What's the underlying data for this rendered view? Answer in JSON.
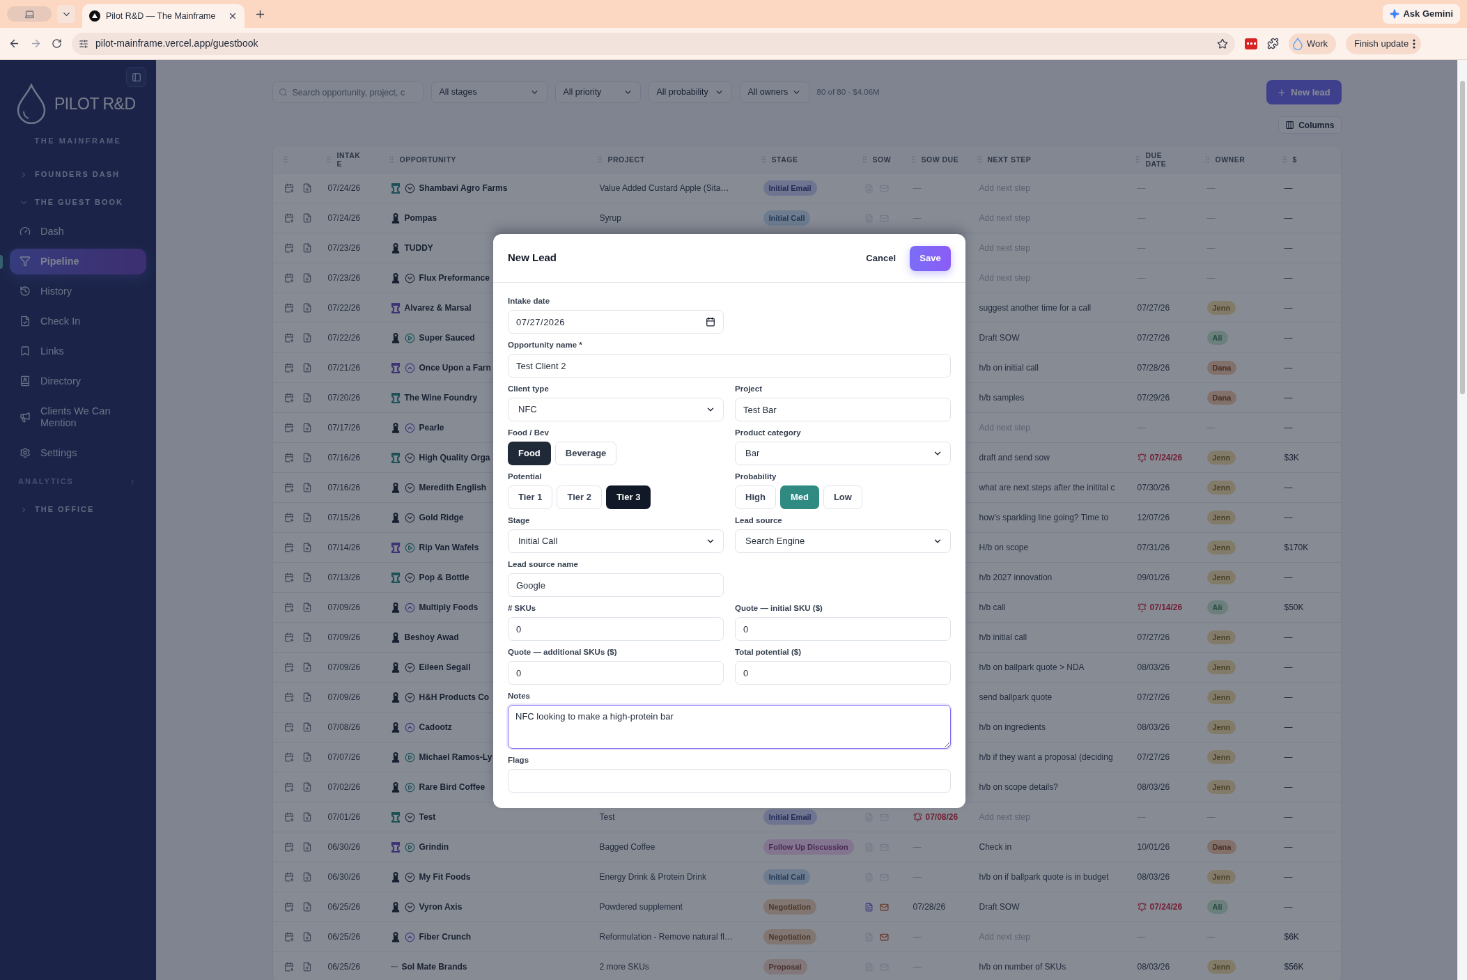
{
  "browser": {
    "tab_title": "Pilot R&D — The Mainframe",
    "gemini": "Ask Gemini",
    "url": "pilot-mainframe.vercel.app/guestbook",
    "profile": "Work",
    "update": "Finish update"
  },
  "sidebar": {
    "brand": "PILOT R&D",
    "subtitle": "THE MAINFRAME",
    "sections": [
      {
        "kind": "group",
        "label": "FOUNDERS DASH",
        "expanded": false
      },
      {
        "kind": "group",
        "label": "THE GUEST BOOK",
        "expanded": true,
        "children": [
          {
            "label": "Dash",
            "selected": false
          },
          {
            "label": "Pipeline",
            "selected": true
          },
          {
            "label": "History",
            "selected": false
          },
          {
            "label": "Check In",
            "selected": false
          },
          {
            "label": "Links",
            "selected": false
          },
          {
            "label": "Directory",
            "selected": false
          },
          {
            "label": "Clients We Can Mention",
            "selected": false
          },
          {
            "label": "Settings",
            "selected": false
          }
        ]
      },
      {
        "kind": "heading",
        "label": "ANALYTICS"
      },
      {
        "kind": "group",
        "label": "THE OFFICE",
        "expanded": false
      }
    ]
  },
  "toolbar": {
    "search_placeholder": "Search opportunity, project, c",
    "filters": [
      "All stages",
      "All priority",
      "All probability",
      "All owners"
    ],
    "summary": "80 of 80 · $4.06M",
    "new_lead": "New lead",
    "columns": "Columns"
  },
  "table": {
    "columns": [
      "INTAKE",
      "OPPORTUNITY",
      "PROJECT",
      "STAGE",
      "SOW",
      "SOW DUE",
      "NEXT STEP",
      "DUE DATE",
      "OWNER",
      "$"
    ],
    "rows": [
      {
        "intake": "07/24/26",
        "type": {
          "kind": "company",
          "color": "#1d5157"
        },
        "status": {
          "kind": "down"
        },
        "name": "Shambavi Agro Farms",
        "project": "Value Added Custard Apple (Sita…",
        "stage": {
          "label": "Initial Email",
          "color": "#6f7591"
        },
        "sow": {
          "doc": false,
          "mail": false
        },
        "sow_due": {
          "text": "—",
          "empty": true,
          "alert": false
        },
        "next_step": {
          "text": "Add next step",
          "empty": true
        },
        "due": {
          "text": "—",
          "empty": true,
          "alert": false
        },
        "owner": {
          "kind": "none",
          "text": "—"
        },
        "amount": "—"
      },
      {
        "intake": "07/24/26",
        "type": {
          "kind": "person",
          "color": "#172031"
        },
        "name": "Pompas",
        "project": "Syrup",
        "stage": {
          "label": "Initial Call",
          "color": "#6e7c90"
        },
        "sow": {
          "doc": false,
          "mail": false
        },
        "sow_due": {
          "text": "—",
          "empty": true,
          "alert": false
        },
        "next_step": {
          "text": "Add next step",
          "empty": true
        },
        "due": {
          "text": "—",
          "empty": true,
          "alert": false
        },
        "owner": {
          "kind": "none",
          "text": "—"
        },
        "amount": "—"
      },
      {
        "intake": "07/23/26",
        "type": {
          "kind": "person",
          "color": "#172031"
        },
        "name": "TUDDY",
        "next_step": {
          "text": "Add next step",
          "empty": true
        },
        "due": {
          "text": "—",
          "empty": true,
          "alert": false
        },
        "owner": {
          "kind": "none",
          "text": "—"
        },
        "amount": "—"
      },
      {
        "intake": "07/23/26",
        "type": {
          "kind": "person",
          "color": "#172031"
        },
        "status": {
          "kind": "down"
        },
        "name": "Flux Preformance",
        "next_step": {
          "text": "Add next step",
          "empty": true
        },
        "due": {
          "text": "—",
          "empty": true,
          "alert": false
        },
        "owner": {
          "kind": "none",
          "text": "—"
        },
        "amount": "—"
      },
      {
        "intake": "07/22/26",
        "type": {
          "kind": "company",
          "color": "#3e3376"
        },
        "name": "Alvarez & Marsal",
        "next_step": {
          "text": "suggest another time for a call",
          "empty": false
        },
        "due": {
          "text": "07/27/26",
          "empty": false,
          "alert": false
        },
        "owner": {
          "kind": "badge",
          "text": "Jenn",
          "color": "#827b69"
        },
        "amount": "—"
      },
      {
        "intake": "07/22/26",
        "type": {
          "kind": "person",
          "color": "#172031"
        },
        "status": {
          "kind": "play"
        },
        "name": "Super Sauced",
        "next_step": {
          "text": "Draft SOW",
          "empty": false
        },
        "due": {
          "text": "07/27/26",
          "empty": false,
          "alert": false
        },
        "owner": {
          "kind": "badge",
          "text": "Ali",
          "color": "#6b7f7d"
        },
        "amount": "—"
      },
      {
        "intake": "07/21/26",
        "type": {
          "kind": "company",
          "color": "#3e3376"
        },
        "status": {
          "kind": "up"
        },
        "name": "Once Upon a Farn",
        "next_step": {
          "text": "h/b on initial call",
          "empty": false
        },
        "due": {
          "text": "07/28/26",
          "empty": false,
          "alert": false
        },
        "owner": {
          "kind": "badge",
          "text": "Dana",
          "color": "#82706b"
        },
        "amount": "—"
      },
      {
        "intake": "07/20/26",
        "type": {
          "kind": "company",
          "color": "#1d5157"
        },
        "name": "The Wine Foundry",
        "next_step": {
          "text": "h/b samples",
          "empty": false
        },
        "due": {
          "text": "07/29/26",
          "empty": false,
          "alert": false
        },
        "owner": {
          "kind": "badge",
          "text": "Dana",
          "color": "#82706b"
        },
        "amount": "—"
      },
      {
        "intake": "07/17/26",
        "type": {
          "kind": "person",
          "color": "#172031"
        },
        "status": {
          "kind": "up"
        },
        "name": "Pearle",
        "next_step": {
          "text": "Add next step",
          "empty": true
        },
        "due": {
          "text": "—",
          "empty": true,
          "alert": false
        },
        "owner": {
          "kind": "none",
          "text": "—"
        },
        "amount": "—"
      },
      {
        "intake": "07/16/26",
        "type": {
          "kind": "company",
          "color": "#1d5157"
        },
        "status": {
          "kind": "down"
        },
        "name": "High Quality Orga",
        "next_step": {
          "text": "draft and send sow",
          "empty": false
        },
        "due": {
          "text": "07/24/26",
          "empty": false,
          "alert": true
        },
        "owner": {
          "kind": "badge",
          "text": "Jenn",
          "color": "#827b69"
        },
        "amount": "$3K"
      },
      {
        "intake": "07/16/26",
        "type": {
          "kind": "person",
          "color": "#172031"
        },
        "status": {
          "kind": "down"
        },
        "name": "Meredith English",
        "next_step": {
          "text": "what are next steps after the initital c",
          "empty": false
        },
        "due": {
          "text": "07/30/26",
          "empty": false,
          "alert": false
        },
        "owner": {
          "kind": "badge",
          "text": "Jenn",
          "color": "#827b69"
        },
        "amount": "—"
      },
      {
        "intake": "07/15/26",
        "type": {
          "kind": "person",
          "color": "#172031"
        },
        "status": {
          "kind": "down"
        },
        "name": "Gold Ridge",
        "next_step": {
          "text": "how's sparkling line going? Time to",
          "empty": false
        },
        "due": {
          "text": "12/07/26",
          "empty": false,
          "alert": false
        },
        "owner": {
          "kind": "badge",
          "text": "Jenn",
          "color": "#827b69"
        },
        "amount": "—"
      },
      {
        "intake": "07/14/26",
        "type": {
          "kind": "company",
          "color": "#3e3376"
        },
        "status": {
          "kind": "play"
        },
        "name": "Rip Van Wafels",
        "next_step": {
          "text": "H/b on scope",
          "empty": false
        },
        "due": {
          "text": "07/31/26",
          "empty": false,
          "alert": false
        },
        "owner": {
          "kind": "badge",
          "text": "Jenn",
          "color": "#827b69"
        },
        "amount": "$170K"
      },
      {
        "intake": "07/13/26",
        "type": {
          "kind": "company",
          "color": "#1d5157"
        },
        "status": {
          "kind": "down"
        },
        "name": "Pop & Bottle",
        "next_step": {
          "text": "h/b 2027 innovation",
          "empty": false
        },
        "due": {
          "text": "09/01/26",
          "empty": false,
          "alert": false
        },
        "owner": {
          "kind": "badge",
          "text": "Jenn",
          "color": "#827b69"
        },
        "amount": "—"
      },
      {
        "intake": "07/09/26",
        "type": {
          "kind": "person",
          "color": "#172031"
        },
        "status": {
          "kind": "up"
        },
        "name": "Multiply Foods",
        "next_step": {
          "text": "h/b call",
          "empty": false
        },
        "due": {
          "text": "07/14/26",
          "empty": false,
          "alert": true
        },
        "owner": {
          "kind": "badge",
          "text": "Ali",
          "color": "#6b7f7d"
        },
        "amount": "$50K"
      },
      {
        "intake": "07/09/26",
        "type": {
          "kind": "person",
          "color": "#172031"
        },
        "name": "Beshoy Awad",
        "next_step": {
          "text": "h/b initial call",
          "empty": false
        },
        "due": {
          "text": "07/27/26",
          "empty": false,
          "alert": false
        },
        "owner": {
          "kind": "badge",
          "text": "Jenn",
          "color": "#827b69"
        },
        "amount": "—"
      },
      {
        "intake": "07/09/26",
        "type": {
          "kind": "person",
          "color": "#172031"
        },
        "status": {
          "kind": "down"
        },
        "name": "Eileen Segall",
        "next_step": {
          "text": "h/b on ballpark quote > NDA",
          "empty": false
        },
        "due": {
          "text": "08/03/26",
          "empty": false,
          "alert": false
        },
        "owner": {
          "kind": "badge",
          "text": "Jenn",
          "color": "#827b69"
        },
        "amount": "—"
      },
      {
        "intake": "07/09/26",
        "type": {
          "kind": "person",
          "color": "#172031"
        },
        "status": {
          "kind": "down"
        },
        "name": "H&H Products Co",
        "next_step": {
          "text": "send ballpark quote",
          "empty": false
        },
        "due": {
          "text": "07/27/26",
          "empty": false,
          "alert": false
        },
        "owner": {
          "kind": "badge",
          "text": "Jenn",
          "color": "#827b69"
        },
        "amount": "—"
      },
      {
        "intake": "07/08/26",
        "type": {
          "kind": "person",
          "color": "#172031"
        },
        "status": {
          "kind": "up"
        },
        "name": "Cadootz",
        "next_step": {
          "text": "h/b on ingredients",
          "empty": false
        },
        "due": {
          "text": "08/03/26",
          "empty": false,
          "alert": false
        },
        "owner": {
          "kind": "badge",
          "text": "Jenn",
          "color": "#827b69"
        },
        "amount": "—"
      },
      {
        "intake": "07/07/26",
        "type": {
          "kind": "person",
          "color": "#172031"
        },
        "status": {
          "kind": "play"
        },
        "name": "Michael Ramos-Ly",
        "next_step": {
          "text": "h/b if they want a proposal (deciding",
          "empty": false
        },
        "due": {
          "text": "07/27/26",
          "empty": false,
          "alert": false
        },
        "owner": {
          "kind": "badge",
          "text": "Jenn",
          "color": "#827b69"
        },
        "amount": "—"
      },
      {
        "intake": "07/02/26",
        "type": {
          "kind": "person",
          "color": "#172031"
        },
        "status": {
          "kind": "play"
        },
        "name": "Rare Bird Coffee",
        "next_step": {
          "text": "h/b on scope details?",
          "empty": false
        },
        "due": {
          "text": "08/03/26",
          "empty": false,
          "alert": false
        },
        "owner": {
          "kind": "badge",
          "text": "Jenn",
          "color": "#827b69"
        },
        "amount": "—"
      },
      {
        "intake": "07/01/26",
        "type": {
          "kind": "company",
          "color": "#1d5157"
        },
        "status": {
          "kind": "down"
        },
        "name": "Test",
        "project": "Test",
        "stage": {
          "label": "Initial Email",
          "color": "#6f7591"
        },
        "sow": {
          "doc": false,
          "mail": false
        },
        "sow_due": {
          "text": "07/08/26",
          "empty": false,
          "alert": true
        },
        "next_step": {
          "text": "Add next step",
          "empty": true
        },
        "due": {
          "text": "—",
          "empty": true,
          "alert": false
        },
        "owner": {
          "kind": "none",
          "text": "—"
        },
        "amount": "—"
      },
      {
        "intake": "06/30/26",
        "type": {
          "kind": "company",
          "color": "#3e3376"
        },
        "status": {
          "kind": "play"
        },
        "name": "Grindin",
        "project": "Bagged Coffee",
        "stage": {
          "label": "Follow Up Discussion",
          "color": "#83748f"
        },
        "sow": {
          "doc": false,
          "mail": false
        },
        "sow_due": {
          "text": "—",
          "empty": true,
          "alert": false
        },
        "next_step": {
          "text": "Check in",
          "empty": false
        },
        "due": {
          "text": "10/01/26",
          "empty": false,
          "alert": false
        },
        "owner": {
          "kind": "badge",
          "text": "Dana",
          "color": "#82706b"
        },
        "amount": "—"
      },
      {
        "intake": "06/30/26",
        "type": {
          "kind": "person",
          "color": "#172031"
        },
        "status": {
          "kind": "down"
        },
        "name": "My Fit Foods",
        "project": "Energy Drink & Protein Drink",
        "stage": {
          "label": "Initial Call",
          "color": "#6e7c90"
        },
        "sow": {
          "doc": false,
          "mail": false
        },
        "sow_due": {
          "text": "—",
          "empty": true,
          "alert": false
        },
        "next_step": {
          "text": "h/b on if ballpark quote is in budget",
          "empty": false
        },
        "due": {
          "text": "08/03/26",
          "empty": false,
          "alert": false
        },
        "owner": {
          "kind": "badge",
          "text": "Jenn",
          "color": "#827b69"
        },
        "amount": "—"
      },
      {
        "intake": "06/25/26",
        "type": {
          "kind": "person",
          "color": "#172031"
        },
        "status": {
          "kind": "down"
        },
        "name": "Vyron Axis",
        "project": "Powdered supplement",
        "stage": {
          "label": "Negotiation",
          "color": "#817671"
        },
        "sow": {
          "doc": true,
          "mail": true
        },
        "sow_due": {
          "text": "07/28/26",
          "empty": false,
          "alert": false
        },
        "next_step": {
          "text": "Draft SOW",
          "empty": false
        },
        "due": {
          "text": "07/24/26",
          "empty": false,
          "alert": true
        },
        "owner": {
          "kind": "badge",
          "text": "Ali",
          "color": "#6b7f7d"
        },
        "amount": "—"
      },
      {
        "intake": "06/25/26",
        "type": {
          "kind": "person",
          "color": "#172031"
        },
        "status": {
          "kind": "up"
        },
        "name": "Fiber Crunch",
        "project": "Reformulation - Remove natural fl…",
        "stage": {
          "label": "Negotiation",
          "color": "#817671"
        },
        "sow": {
          "doc": false,
          "mail": true
        },
        "sow_due": {
          "text": "—",
          "empty": true,
          "alert": false
        },
        "next_step": {
          "text": "Add next step",
          "empty": true
        },
        "due": {
          "text": "—",
          "empty": true,
          "alert": false
        },
        "owner": {
          "kind": "none",
          "text": "—"
        },
        "amount": "$6K"
      },
      {
        "intake": "06/25/26",
        "type": {
          "kind": "none"
        },
        "name": "Sol Mate Brands",
        "project": "2 more SKUs",
        "stage": {
          "label": "Proposal",
          "color": "#82777a"
        },
        "sow": {
          "doc": false,
          "mail": false
        },
        "sow_due": {
          "text": "—",
          "empty": true,
          "alert": false
        },
        "next_step": {
          "text": "h/b on number of SKUs",
          "empty": false
        },
        "due": {
          "text": "08/03/26",
          "empty": false,
          "alert": false
        },
        "owner": {
          "kind": "badge",
          "text": "Jenn",
          "color": "#827b69"
        },
        "amount": "$56K"
      }
    ]
  },
  "modal": {
    "title": "New Lead",
    "cancel": "Cancel",
    "save": "Save",
    "rows": [
      {
        "wide": false,
        "fields": [
          {
            "kind": "date",
            "label": "Intake date",
            "value": "07/27/2026"
          }
        ]
      },
      {
        "wide": true,
        "fields": [
          {
            "kind": "text",
            "label": "Opportunity name *",
            "value": "Test Client 2"
          }
        ]
      },
      {
        "wide": false,
        "fields": [
          {
            "kind": "select",
            "label": "Client type",
            "value": "NFC"
          },
          {
            "kind": "text",
            "label": "Project",
            "value": "Test Bar"
          }
        ]
      },
      {
        "wide": false,
        "fields": [
          {
            "kind": "segmented",
            "label": "Food / Bev",
            "color": "#1f2937",
            "options": [
              {
                "label": "Food",
                "selected": true
              },
              {
                "label": "Beverage",
                "selected": false
              }
            ]
          },
          {
            "kind": "select",
            "label": "Product category",
            "value": "Bar"
          }
        ]
      },
      {
        "wide": false,
        "fields": [
          {
            "kind": "segmented",
            "label": "Potential",
            "color": "#111827",
            "options": [
              {
                "label": "Tier 1",
                "selected": false
              },
              {
                "label": "Tier 2",
                "selected": false
              },
              {
                "label": "Tier 3",
                "selected": true
              }
            ]
          },
          {
            "kind": "segmented",
            "label": "Probability",
            "color": "#2f8a82",
            "options": [
              {
                "label": "High",
                "selected": false
              },
              {
                "label": "Med",
                "selected": true
              },
              {
                "label": "Low",
                "selected": false
              }
            ]
          }
        ]
      },
      {
        "wide": false,
        "fields": [
          {
            "kind": "select",
            "label": "Stage",
            "value": "Initial Call"
          },
          {
            "kind": "select",
            "label": "Lead source",
            "value": "Search Engine"
          }
        ]
      },
      {
        "wide": false,
        "fields": [
          {
            "kind": "text",
            "label": "Lead source name",
            "value": "Google"
          }
        ]
      },
      {
        "wide": false,
        "fields": [
          {
            "kind": "text",
            "label": "# SKUs",
            "value": "0"
          },
          {
            "kind": "text",
            "label": "Quote — initial SKU ($)",
            "value": "0"
          }
        ]
      },
      {
        "wide": false,
        "fields": [
          {
            "kind": "text",
            "label": "Quote — additional SKUs ($)",
            "value": "0"
          },
          {
            "kind": "text",
            "label": "Total potential ($)",
            "value": "0"
          }
        ]
      },
      {
        "wide": true,
        "fields": [
          {
            "kind": "textarea",
            "label": "Notes",
            "value": "NFC looking to make a high-protein bar",
            "focused": true
          }
        ]
      },
      {
        "wide": true,
        "fields": [
          {
            "kind": "text",
            "label": "Flags"
          }
        ]
      }
    ]
  }
}
